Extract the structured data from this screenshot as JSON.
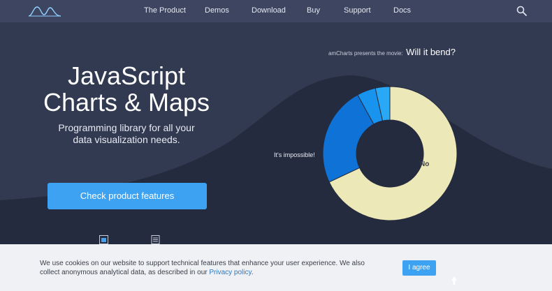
{
  "nav": {
    "items": [
      {
        "label": "The Product"
      },
      {
        "label": "Demos"
      },
      {
        "label": "Download"
      },
      {
        "label": "Buy"
      },
      {
        "label": "Support"
      },
      {
        "label": "Docs"
      }
    ]
  },
  "hero": {
    "title_line1": "JavaScript",
    "title_line2": "Charts & Maps",
    "subtitle_line1": "Programming library for all your",
    "subtitle_line2": "data visualization needs.",
    "cta_label": "Check product features"
  },
  "movie": {
    "prefix": "amCharts presents the movie:",
    "title": "Will it bend?"
  },
  "chart_data": {
    "type": "pie",
    "categories": [
      "No",
      "It's impossible!",
      "",
      ""
    ],
    "values": [
      68,
      24,
      4.5,
      3.5
    ],
    "colors": [
      "#ece8b8",
      "#0f72d6",
      "#1893ee",
      "#29a8f6"
    ],
    "labels": [
      "No",
      "It's impossible!"
    ]
  },
  "cookie": {
    "text": "We use cookies on our website to support technical features that enhance your user experience. We also collect anonymous analytical data, as described in our ",
    "link": "Privacy policy",
    "suffix": ".",
    "button": "I agree"
  },
  "colors": {
    "background": "#323a51",
    "nav": "#3d4560",
    "accent": "#3ea2f3"
  }
}
